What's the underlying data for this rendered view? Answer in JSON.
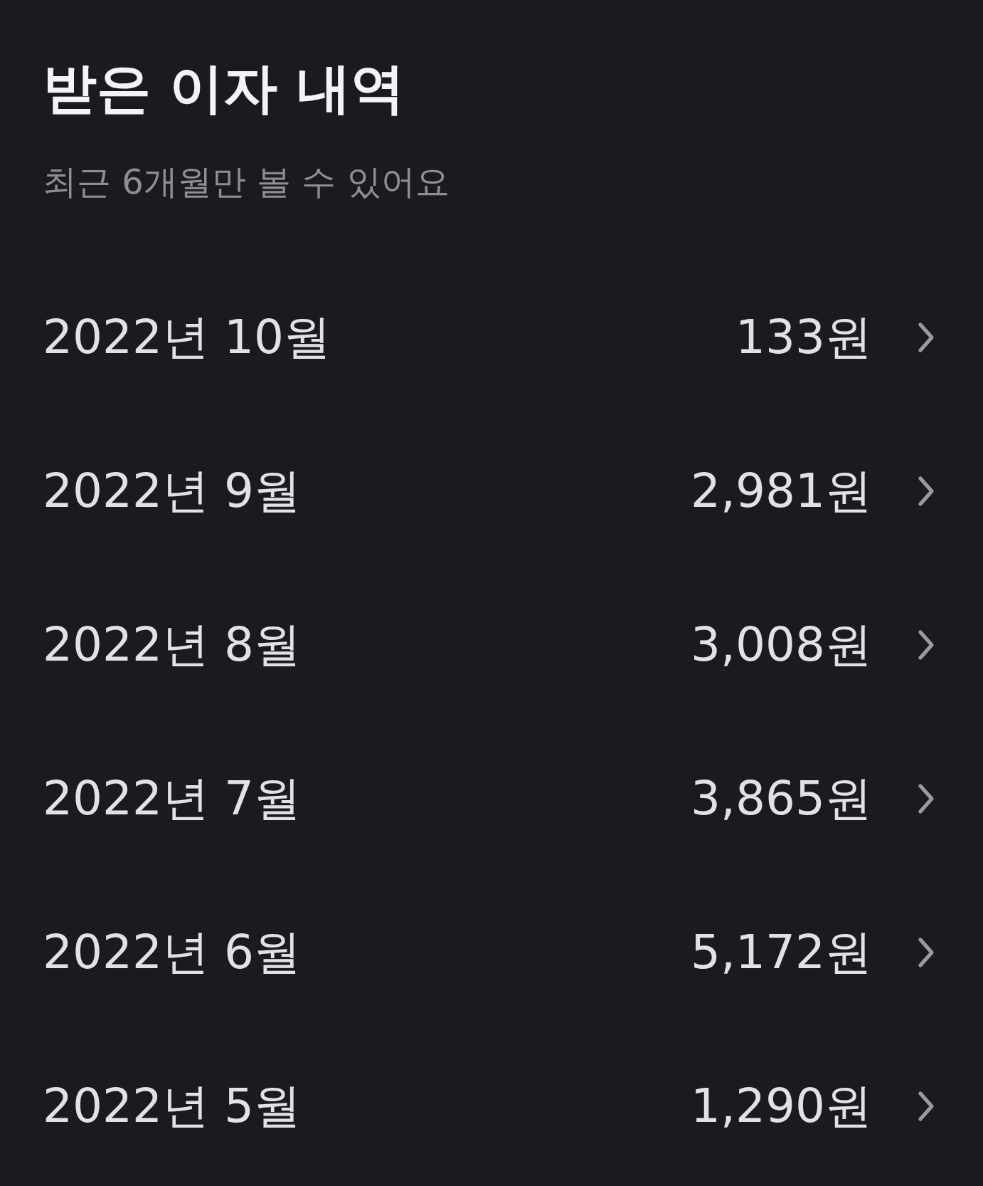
{
  "header": {
    "title": "받은 이자 내역",
    "subtitle": "최근 6개월만 볼 수 있어요"
  },
  "rows": [
    {
      "month": "2022년 10월",
      "amount": "133원"
    },
    {
      "month": "2022년 9월",
      "amount": "2,981원"
    },
    {
      "month": "2022년 8월",
      "amount": "3,008원"
    },
    {
      "month": "2022년 7월",
      "amount": "3,865원"
    },
    {
      "month": "2022년 6월",
      "amount": "5,172원"
    },
    {
      "month": "2022년 5월",
      "amount": "1,290원"
    }
  ]
}
